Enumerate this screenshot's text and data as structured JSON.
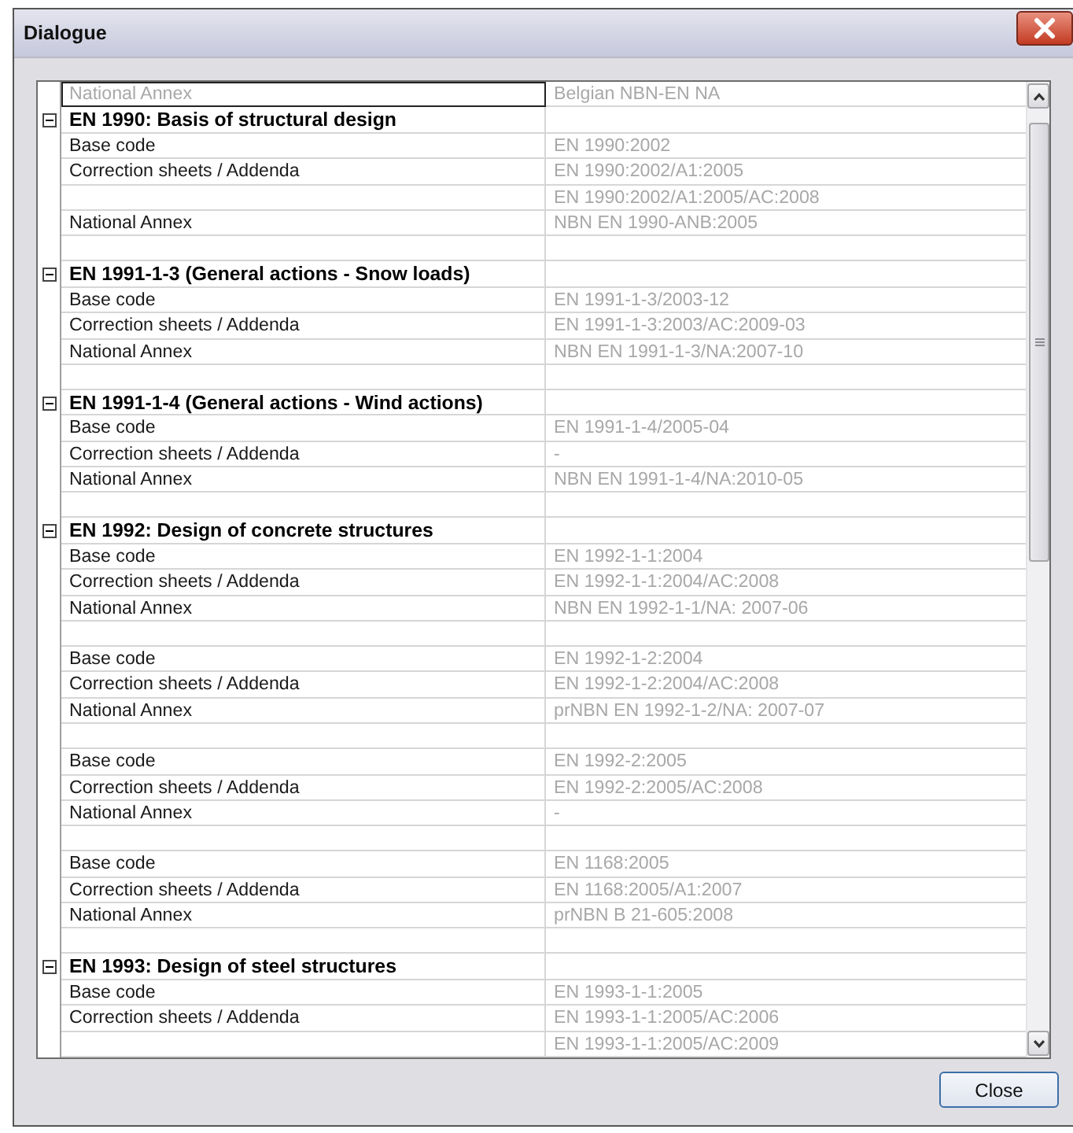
{
  "window": {
    "title": "Dialogue"
  },
  "grid": {
    "top_row": {
      "label": "National Annex",
      "value": "Belgian NBN-EN NA",
      "selected": true
    },
    "groups": [
      {
        "title": "EN 1990: Basis of structural design",
        "expanded": true,
        "rows": [
          {
            "kind": "entry",
            "label": "Base code",
            "value": "EN 1990:2002"
          },
          {
            "kind": "entry",
            "label": "Correction sheets / Addenda",
            "value": "EN 1990:2002/A1:2005"
          },
          {
            "kind": "entry",
            "value": "EN 1990:2002/A1:2005/AC:2008"
          },
          {
            "kind": "entry",
            "label": "National Annex",
            "value": "NBN EN 1990-ANB:2005"
          },
          {
            "kind": "spacer"
          }
        ]
      },
      {
        "title": "EN 1991-1-3 (General actions - Snow loads)",
        "expanded": true,
        "rows": [
          {
            "kind": "entry",
            "label": "Base code",
            "value": "EN 1991-1-3/2003-12"
          },
          {
            "kind": "entry",
            "label": "Correction sheets / Addenda",
            "value": "EN 1991-1-3:2003/AC:2009-03"
          },
          {
            "kind": "entry",
            "label": "National Annex",
            "value": "NBN EN 1991-1-3/NA:2007-10"
          },
          {
            "kind": "spacer"
          }
        ]
      },
      {
        "title": "EN 1991-1-4 (General actions - Wind actions)",
        "expanded": true,
        "rows": [
          {
            "kind": "entry",
            "label": "Base code",
            "value": "EN 1991-1-4/2005-04"
          },
          {
            "kind": "entry",
            "label": "Correction sheets / Addenda",
            "value": "-"
          },
          {
            "kind": "entry",
            "label": "National Annex",
            "value": "NBN EN 1991-1-4/NA:2010-05"
          },
          {
            "kind": "spacer"
          }
        ]
      },
      {
        "title": "EN 1992: Design of concrete structures",
        "expanded": true,
        "rows": [
          {
            "kind": "entry",
            "label": "Base code",
            "value": "EN 1992-1-1:2004"
          },
          {
            "kind": "entry",
            "label": "Correction sheets / Addenda",
            "value": "EN 1992-1-1:2004/AC:2008"
          },
          {
            "kind": "entry",
            "label": "National Annex",
            "value": "NBN EN 1992-1-1/NA: 2007-06"
          },
          {
            "kind": "spacer"
          },
          {
            "kind": "entry",
            "label": "Base code",
            "value": "EN 1992-1-2:2004"
          },
          {
            "kind": "entry",
            "label": "Correction sheets / Addenda",
            "value": "EN 1992-1-2:2004/AC:2008"
          },
          {
            "kind": "entry",
            "label": "National Annex",
            "value": "prNBN EN 1992-1-2/NA: 2007-07"
          },
          {
            "kind": "spacer"
          },
          {
            "kind": "entry",
            "label": "Base code",
            "value": "EN 1992-2:2005"
          },
          {
            "kind": "entry",
            "label": "Correction sheets / Addenda",
            "value": "EN 1992-2:2005/AC:2008"
          },
          {
            "kind": "entry",
            "label": "National Annex",
            "value": "-"
          },
          {
            "kind": "spacer"
          },
          {
            "kind": "entry",
            "label": "Base code",
            "value": "EN 1168:2005"
          },
          {
            "kind": "entry",
            "label": "Correction sheets / Addenda",
            "value": "EN 1168:2005/A1:2007"
          },
          {
            "kind": "entry",
            "label": "National Annex",
            "value": "prNBN B 21-605:2008"
          },
          {
            "kind": "spacer"
          }
        ]
      },
      {
        "title": "EN 1993: Design of steel structures",
        "expanded": true,
        "rows": [
          {
            "kind": "entry",
            "label": "Base code",
            "value": "EN 1993-1-1:2005"
          },
          {
            "kind": "entry",
            "label": "Correction sheets / Addenda",
            "value": "EN 1993-1-1:2005/AC:2006"
          },
          {
            "kind": "entry",
            "value": "EN 1993-1-1:2005/AC:2009"
          }
        ]
      }
    ]
  },
  "buttons": [
    {
      "label": "Close"
    }
  ]
}
